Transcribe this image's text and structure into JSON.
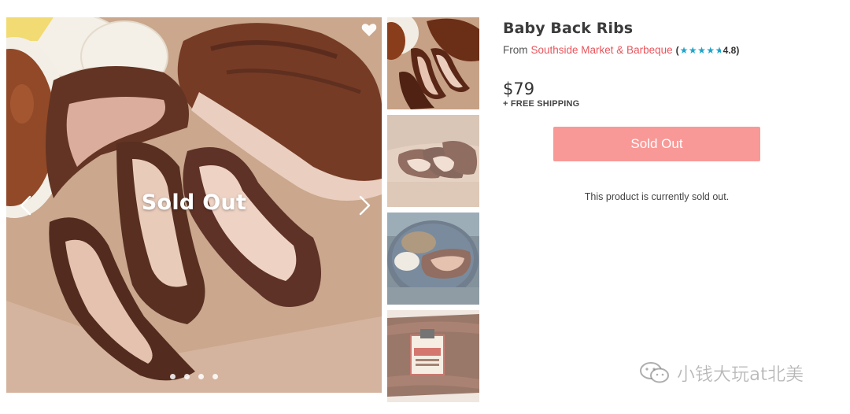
{
  "product": {
    "title": "Baby Back Ribs",
    "from_label": "From",
    "vendor": "Southside Market & Barbeque",
    "rating_value": "4.8",
    "rating_stars": 4.8,
    "price": "$79",
    "shipping": "+ FREE SHIPPING",
    "button_label": "Sold Out",
    "sold_out_message": "This product is currently sold out."
  },
  "gallery": {
    "overlay_text": "Sold Out",
    "image_count": 4,
    "active_index": 0,
    "thumbnails": [
      "ribs-plate",
      "ribs-sliced",
      "ribs-dinner-plate",
      "ribs-package"
    ]
  },
  "watermark": {
    "text": "小钱大玩at北美"
  },
  "colors": {
    "accent": "#e8555c",
    "button": "#f89997",
    "stars": "#1fa3c9"
  }
}
